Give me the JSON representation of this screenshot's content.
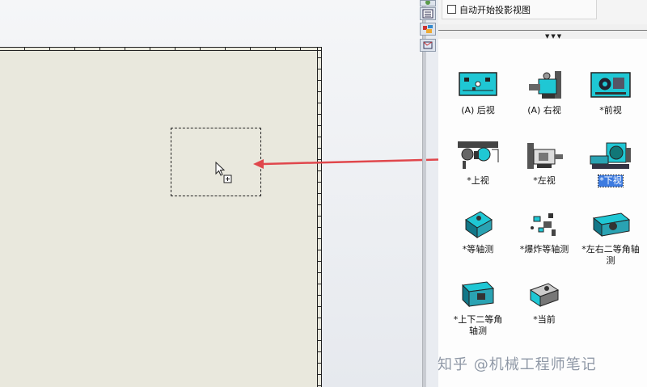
{
  "panel": {
    "auto_start_label": "自动开始投影视图",
    "auto_start_checked": false
  },
  "views": [
    {
      "label": "(A) 后视",
      "selected": false
    },
    {
      "label": "(A) 右视",
      "selected": false
    },
    {
      "label": "*前视",
      "selected": false
    },
    {
      "label": "*上视",
      "selected": false
    },
    {
      "label": "*左视",
      "selected": false
    },
    {
      "label": "*下视",
      "selected": true
    },
    {
      "label": "*等轴测",
      "selected": false
    },
    {
      "label": "*爆炸等轴测",
      "selected": false
    },
    {
      "label": "*左右二等角轴测",
      "selected": false
    },
    {
      "label": "*上下二等角轴测",
      "selected": false
    },
    {
      "label": "*当前",
      "selected": false
    }
  ],
  "watermark": "知乎 @机械工程师笔记",
  "colors": {
    "accent_arrow": "#e0474c",
    "selection": "#3d7be0",
    "sheet": "#e9e8dd",
    "model_cyan": "#1fc7d4"
  },
  "icons": {
    "toolbar": [
      "design-library-icon",
      "property-list-icon",
      "palette-icon",
      "view-palette-icon"
    ]
  }
}
